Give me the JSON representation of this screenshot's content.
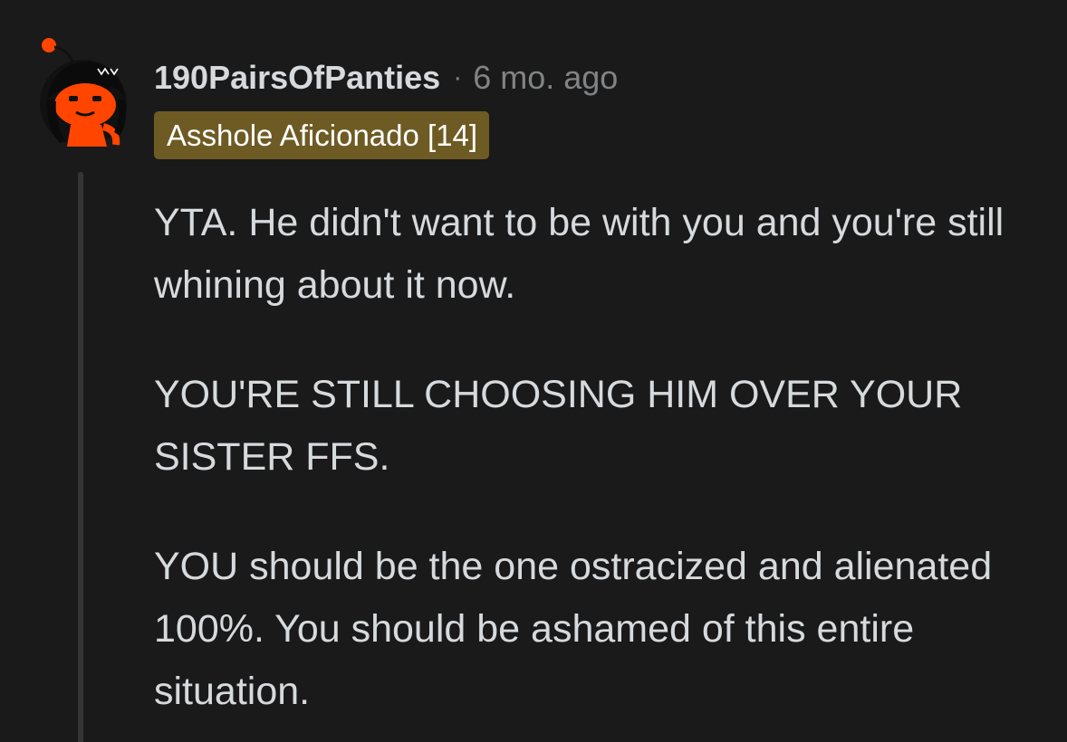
{
  "comment": {
    "username": "190PairsOfPanties",
    "separator": "·",
    "timestamp": "6 mo. ago",
    "flair": "Asshole Aficionado [14]",
    "flair_color": "#6e5b24",
    "avatar_icon": "snoo-avatar-icon",
    "paragraphs": [
      "YTA. He didn't want to be with you and you're still whining about it now.",
      "YOU'RE STILL CHOOSING HIM OVER YOUR SISTER FFS.",
      "YOU should be the one ostracized and alienated 100%. You should be ashamed of this entire situation."
    ]
  },
  "colors": {
    "background": "#1a1a1b",
    "text": "#d7dadc",
    "meta_text": "#818384",
    "thread_line": "#343536"
  }
}
